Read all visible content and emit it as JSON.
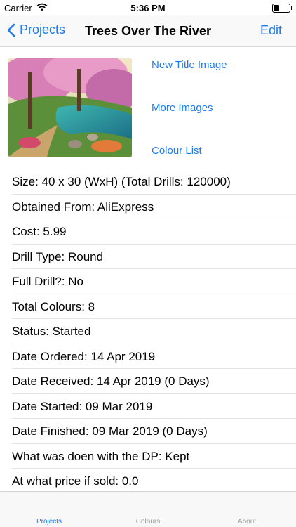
{
  "status": {
    "carrier": "Carrier",
    "time": "5:36 PM",
    "battery_level": 0.3
  },
  "nav": {
    "back_label": "Projects",
    "title": "Trees Over The River",
    "edit_label": "Edit"
  },
  "header": {
    "links": [
      "New Title Image",
      "More Images",
      "Colour List"
    ]
  },
  "details": [
    "Size: 40 x 30 (WxH) (Total Drills: 120000)",
    "Obtained From: AliExpress",
    "Cost: 5.99",
    "Drill Type: Round",
    "Full Drill?: No",
    "Total Colours: 8",
    "Status: Started",
    "Date Ordered: 14 Apr 2019",
    "Date Received: 14 Apr 2019 (0 Days)",
    "Date Started: 09 Mar 2019",
    "Date Finished: 09 Mar 2019 (0 Days)",
    "What was doen with the DP: Kept",
    "At what price if sold: 0.0"
  ],
  "tabs": [
    "Projects",
    "Colours",
    "About"
  ],
  "colors": {
    "accent": "#1a7cf3"
  }
}
